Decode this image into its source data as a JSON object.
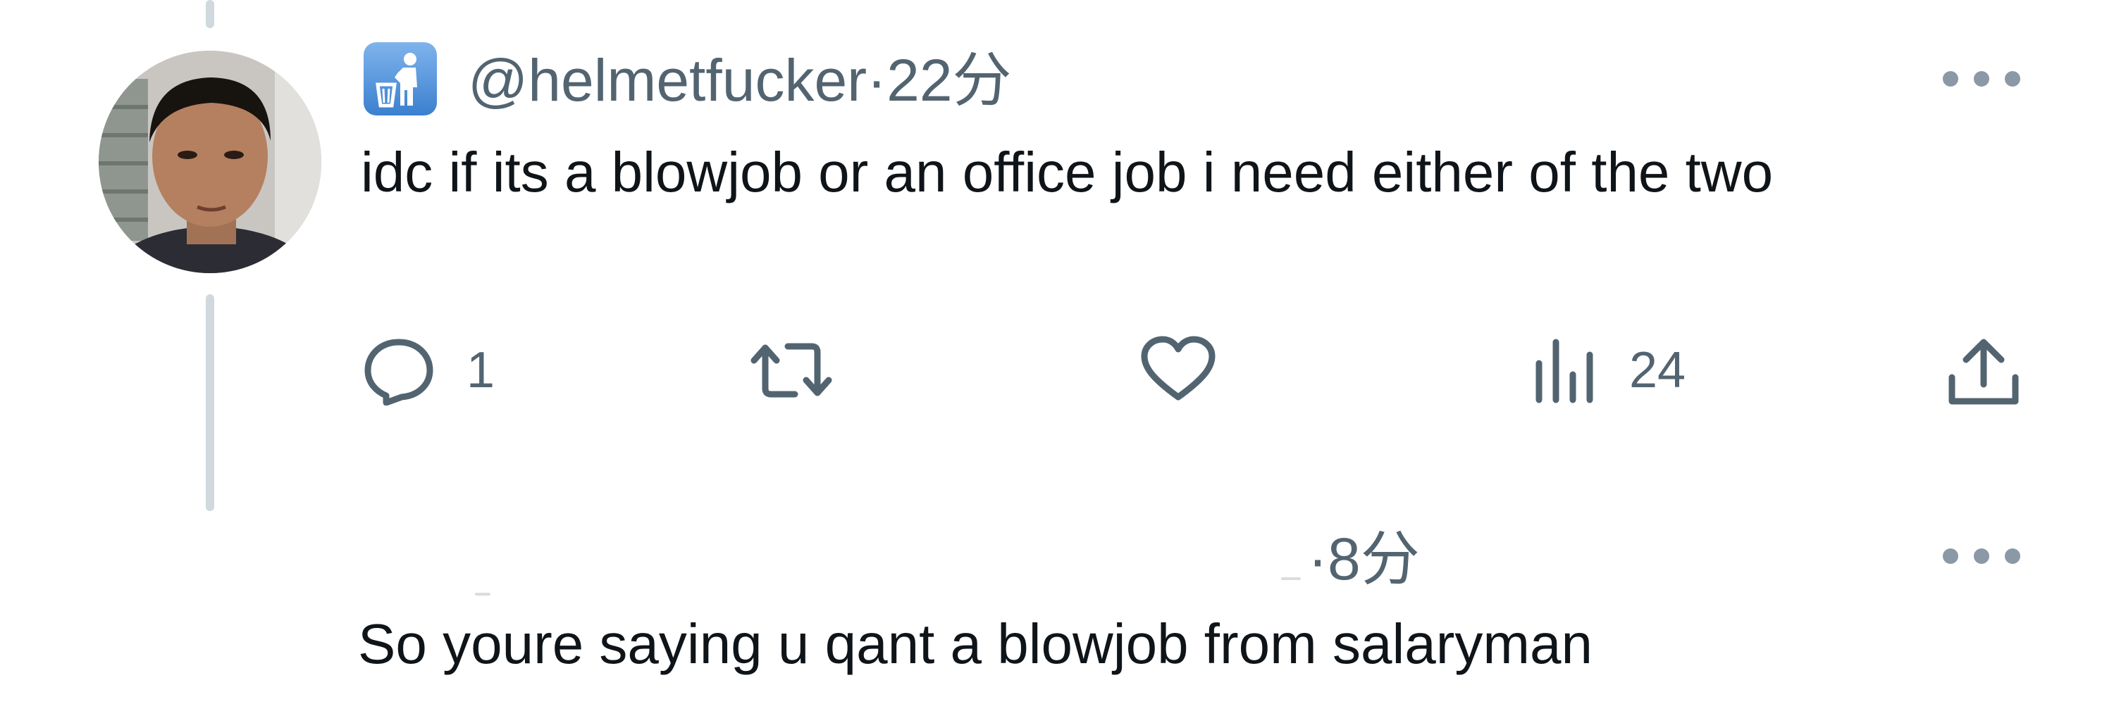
{
  "tweet": {
    "handle": "@helmetfucker",
    "separator": "·",
    "time": "22分",
    "text": "idc if its a blowjob or an office job i need either of the two",
    "actions": {
      "reply_count": "1",
      "retweet_count": "",
      "like_count": "",
      "views_count": "24"
    },
    "badge_icon": "trash-person-icon"
  },
  "reply": {
    "separator": "·",
    "time": "8分",
    "text": "So youre saying u qant a blowjob from salaryman"
  },
  "colors": {
    "text_primary": "#0f1419",
    "text_secondary": "#536471",
    "thread_line": "#cfd9de",
    "badge_blue": "#4a8fd9"
  }
}
